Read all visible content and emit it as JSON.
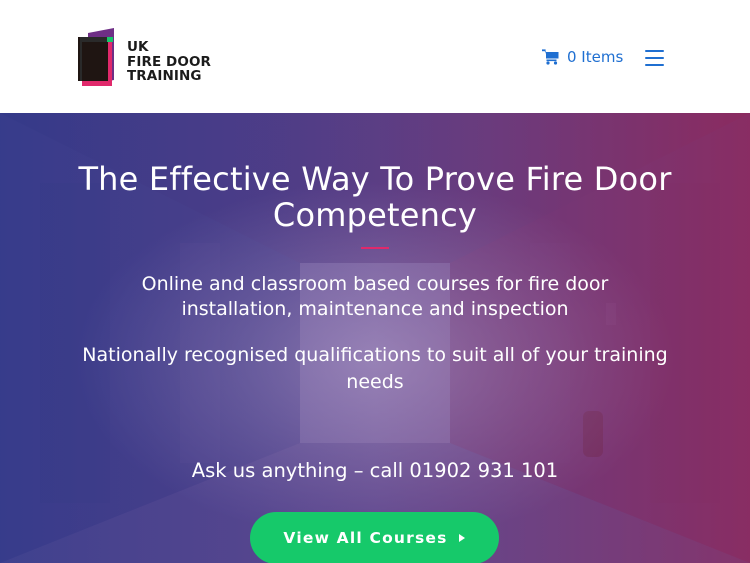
{
  "brand": {
    "lines": [
      "UK",
      "FIRE DOOR",
      "TRAINING"
    ],
    "colors": {
      "primary": "#1f6fd1",
      "accent": "#e0296b",
      "cta": "#16c96a"
    }
  },
  "header": {
    "cart_icon": "shopping-cart-icon",
    "cart_label": "0 Items",
    "menu_icon": "hamburger-menu-icon"
  },
  "hero": {
    "title": "The Effective Way To Prove Fire Door Competency",
    "subtitle_1": "Online and classroom based courses for fire door installation, maintenance and inspection",
    "subtitle_2": "Nationally recognised qualifications to suit all of your training needs",
    "contact": "Ask us anything – call 01902 931 101",
    "cta_label": "View All Courses",
    "cta_icon": "caret-right-icon"
  }
}
